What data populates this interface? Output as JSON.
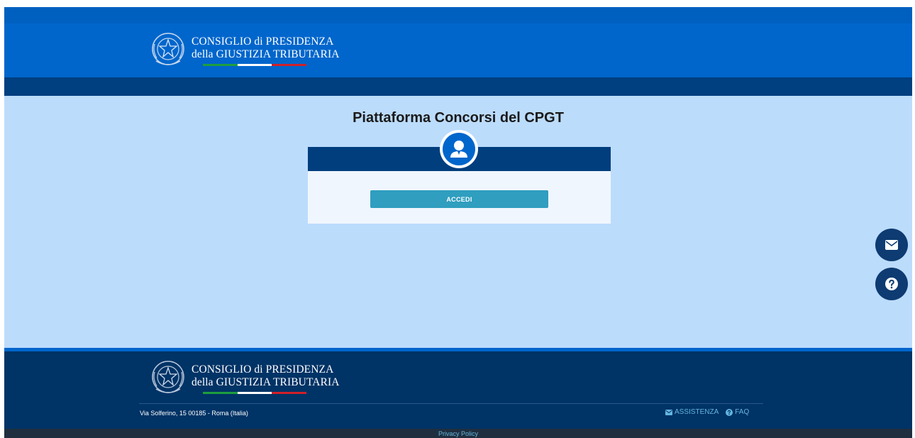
{
  "header": {
    "brand_line1": "CONSIGLIO di PRESIDENZA",
    "brand_line2": "della GIUSTIZIA TRIBUTARIA"
  },
  "main": {
    "title": "Piattaforma Concorsi del CPGT",
    "login_button": "ACCEDI",
    "avatar_icon": "user-icon"
  },
  "floating": {
    "mail_icon": "envelope-icon",
    "help_icon": "question-icon"
  },
  "footer": {
    "brand_line1": "CONSIGLIO di PRESIDENZA",
    "brand_line2": "della GIUSTIZIA TRIBUTARIA",
    "address": "Via Solferino, 15 00185 - Roma (Italia)",
    "link_assistenza": "ASSISTENZA",
    "link_faq": "FAQ",
    "privacy": "Privacy Policy"
  },
  "colors": {
    "header_blue": "#0066cc",
    "dark_blue": "#003366",
    "page_background": "#bcdcfc",
    "button_teal": "#2f9ebf",
    "link_cyan": "#63b6e0"
  }
}
